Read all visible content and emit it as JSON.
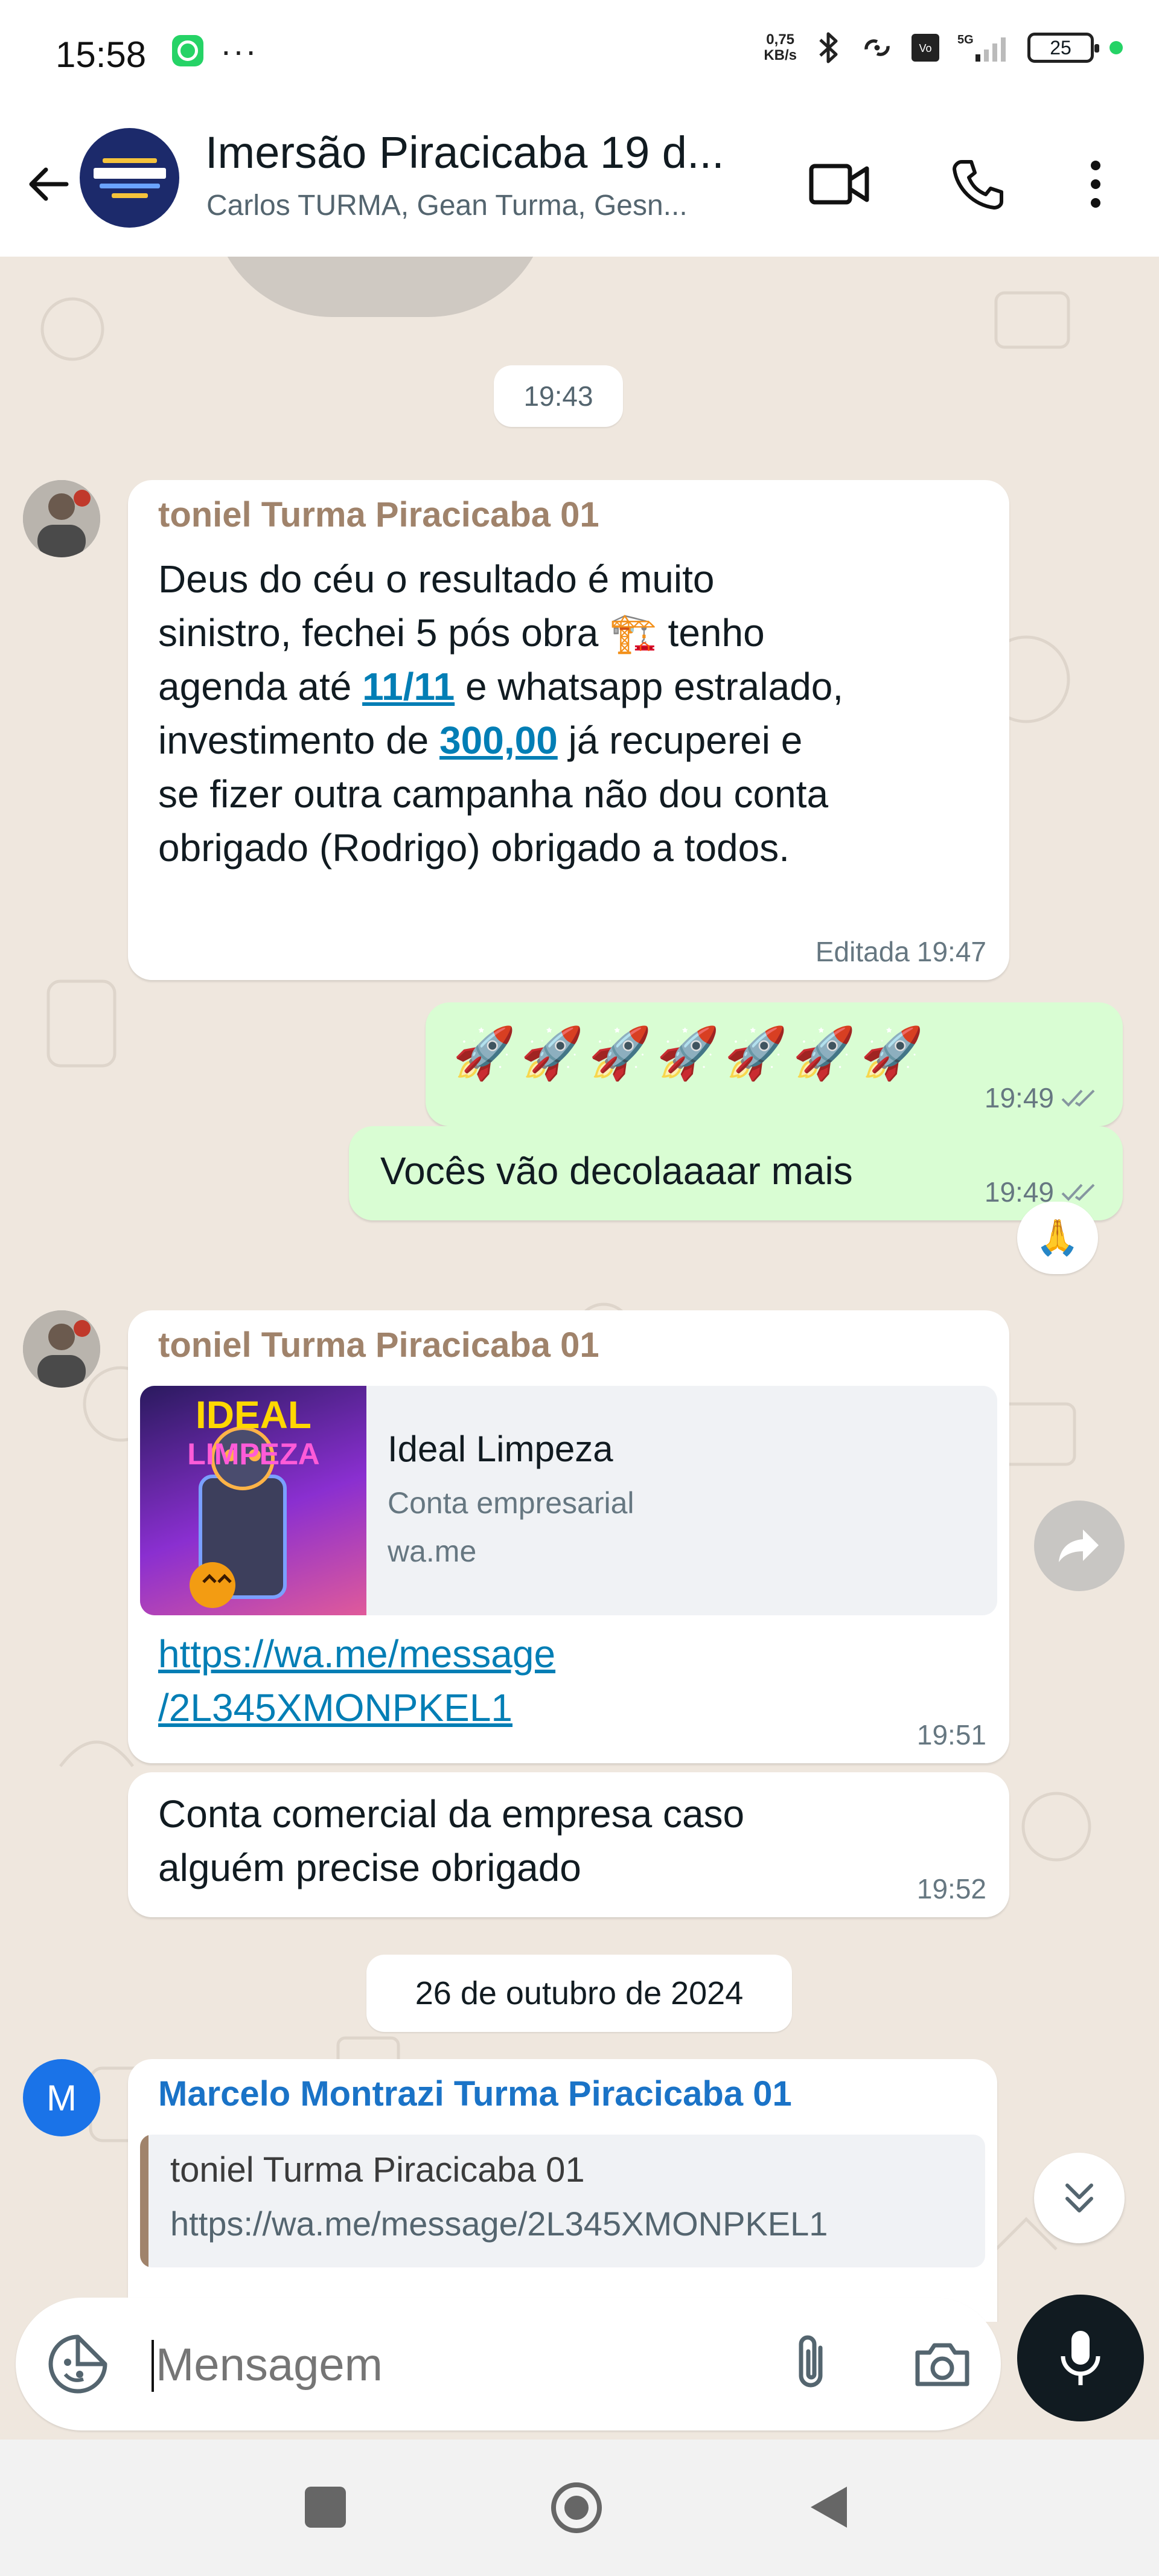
{
  "status_bar": {
    "time": "15:58",
    "net_speed_value": "0,75",
    "net_speed_unit": "KB/s",
    "network": "5G",
    "battery": "25",
    "icons": [
      "whatsapp-icon",
      "more-dots-icon",
      "bluetooth-icon",
      "hotspot-icon",
      "volte-icon",
      "signal-icon",
      "battery-icon"
    ]
  },
  "header": {
    "title": "Imersão Piracicaba 19 d...",
    "subtitle": "Carlos TURMA, Gean Turma, Gesn...",
    "icons": [
      "back-arrow-icon",
      "video-call-icon",
      "phone-icon",
      "more-vert-icon"
    ]
  },
  "chat": {
    "time_chip": "19:43",
    "date_chip": "26 de outubro de 2024",
    "messages": [
      {
        "sender": "toniel Turma Piracicaba 01",
        "lines": {
          "l1": "Deus do céu o resultado é muito",
          "l2a": "sinistro, fechei  5 pós obra ",
          "l2b": " tenho",
          "l3a": "agenda até ",
          "l3link": "11/11",
          "l3b": " e whatsapp estralado,",
          "l4a": "investimento de ",
          "l4link": "300,00",
          "l4b": " já recuperei e",
          "l5": "se fizer outra campanha não dou conta",
          "l6": "obrigado (Rodrigo) obrigado a todos."
        },
        "emoji": "🏗️",
        "edited_label": "Editada",
        "time": "19:47"
      },
      {
        "text": "🚀🚀🚀🚀🚀🚀🚀",
        "time": "19:49"
      },
      {
        "text": "Vocês vão decolaaaar mais",
        "time": "19:49",
        "reaction": "🙏"
      },
      {
        "sender": "toniel Turma Piracicaba 01",
        "preview": {
          "title": "Ideal Limpeza",
          "subtitle": "Conta empresarial",
          "domain": "wa.me",
          "image_text_1": "IDEAL",
          "image_text_2": "LIMPEZA"
        },
        "link_line1": "https://wa.me/message",
        "link_line2": "/2L345XMONPKEL1",
        "time": "19:51"
      },
      {
        "line1": "Conta comercial da empresa caso",
        "line2": "alguém precise  obrigado",
        "time": "19:52"
      },
      {
        "sender": "Marcelo Montrazi Turma Piracicaba 01",
        "avatar_letter": "M",
        "quote": {
          "sender": "toniel Turma Piracicaba 01",
          "text": "https://wa.me/message/2L345XMONPKEL1"
        }
      }
    ]
  },
  "input": {
    "placeholder": "Mensagem"
  },
  "colors": {
    "chat_bg": "#efe7de",
    "outgoing_bubble": "#d9fdd3",
    "incoming_bubble": "#ffffff",
    "sender_toniel": "#a0836b",
    "sender_marcelo": "#1a73c7",
    "link": "#027eb5",
    "tick_read": "#8696a0"
  }
}
